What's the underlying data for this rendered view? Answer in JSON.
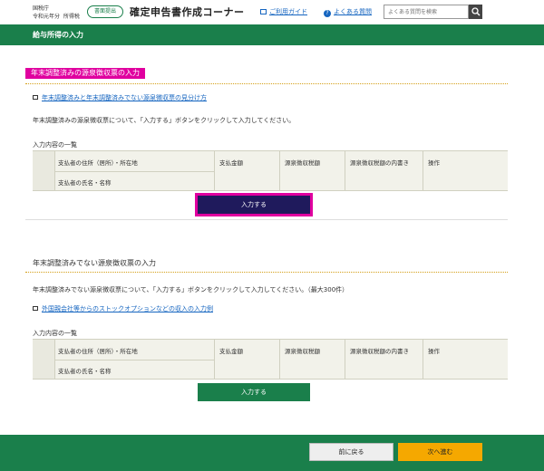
{
  "header": {
    "agency": "国税庁",
    "year_label": "令和元年分",
    "tax_type": "所得税",
    "badge": "書面提出",
    "site_title": "確定申告書作成コーナー",
    "guide_link": "ご利用ガイド",
    "faq_link": "よくある質問",
    "search_placeholder": "よくある質問を検索"
  },
  "page_title": "給与所得の入力",
  "section1": {
    "heading": "年末調整済みの源泉徴収票の入力",
    "link": "年末調整済みと年末調整済みでない源泉徴収票の見分け方",
    "description": "年末調整済みの源泉徴収票について、「入力する」ボタンをクリックして入力してください。",
    "list_label": "入力内容の一覧",
    "button": "入力する"
  },
  "section2": {
    "heading": "年末調整済みでない源泉徴収票の入力",
    "description": "年末調整済みでない源泉徴収票について、「入力する」ボタンをクリックして入力してください。（最大300件）",
    "link": "外国親会社等からのストックオプションなどの収入の入力例",
    "list_label": "入力内容の一覧",
    "button": "入力する"
  },
  "table_headers": {
    "payer_address": "支払者の住所（居所）・所在地",
    "payer_name": "支払者の氏名・名称",
    "amount": "支払金額",
    "withholding": "源泉徴収税額",
    "breakdown": "源泉徴収税額の内書き",
    "operation": "操作"
  },
  "footer": {
    "back": "前に戻る",
    "next": "次へ進む"
  },
  "colors": {
    "brand_green": "#1a7f4b",
    "highlight": "#e0009f",
    "next_button": "#f5a800"
  }
}
